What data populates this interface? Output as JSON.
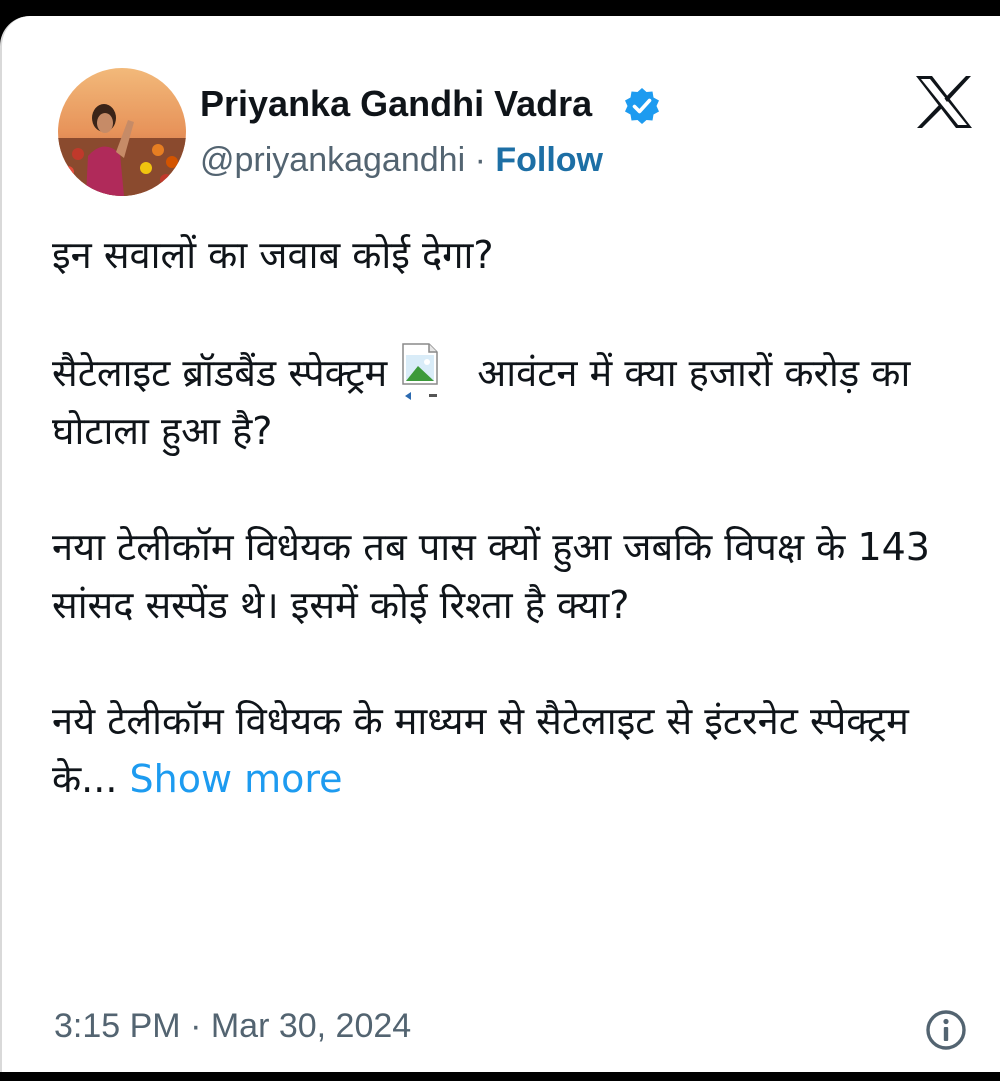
{
  "post": {
    "author": {
      "name": "Priyanka Gandhi Vadra",
      "handle": "@priyankagandhi",
      "separator": " · ",
      "follow_label": "Follow",
      "avatar_icon": "profile-photo",
      "verified_icon": "verified-badge-icon"
    },
    "platform_icon": "x-logo-icon",
    "paragraphs": {
      "p1": "इन सवालों का जवाब कोई देगा?",
      "p2_before": "सैटेलाइट ब्रॉडबैंड स्पेक्ट्रम",
      "p2_after": "आवंटन में क्या हजारों करोड़ का घोटाला हुआ है?",
      "p3": "नया टेलीकॉम विधेयक तब पास क्यों हुआ जबकि विपक्ष के 143 सांसद सस्पेंड थे। इसमें कोई रिश्ता है क्या?",
      "p4": "नये टेलीकॉम विधेयक के माध्यम से सैटेलाइट से इंटरनेट स्पेक्ट्रम के..."
    },
    "inline_image_icon": "broken-image-icon",
    "show_more_label": "Show more",
    "timestamp": "3:15 PM · Mar 30, 2024",
    "info_icon": "info-icon",
    "colors": {
      "follow": "#1d6fa5",
      "show_more": "#1d9bf0",
      "verified": "#1d9bf0",
      "secondary_text": "#536471",
      "primary_text": "#0f1419"
    }
  }
}
